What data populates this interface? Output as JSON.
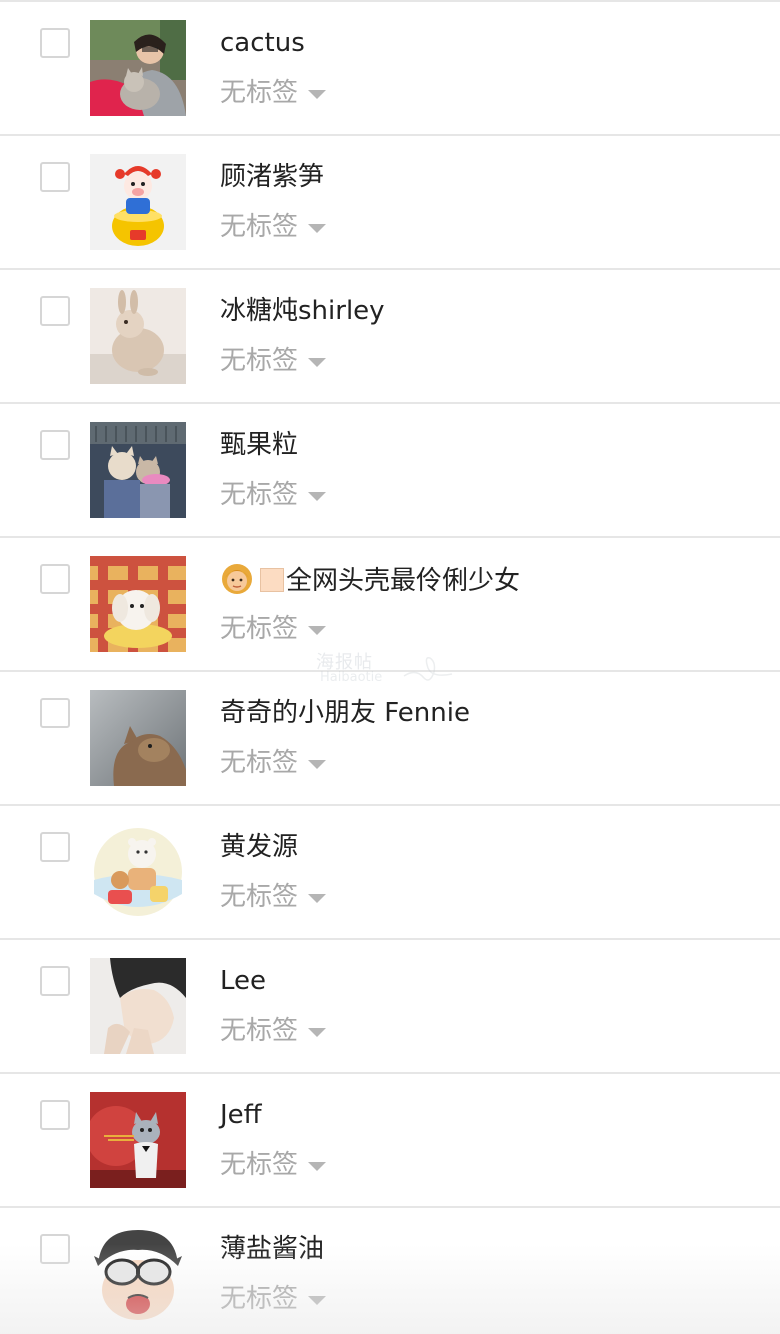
{
  "contacts": [
    {
      "name": "cactus",
      "tag_label": "无标签",
      "avatar": "woman-holding-cat-photo"
    },
    {
      "name": "顾渚紫笋",
      "tag_label": "无标签",
      "avatar": "golden-money-pig-cartoon"
    },
    {
      "name": "冰糖炖shirley",
      "tag_label": "无标签",
      "avatar": "rabbit-photo"
    },
    {
      "name": "甄果粒",
      "tag_label": "无标签",
      "avatar": "two-cats-photo"
    },
    {
      "name": "全网头壳最伶俐少女",
      "tag_label": "无标签",
      "avatar": "white-puppy-on-plaid-photo",
      "name_prefix_icons": [
        "woman-emoji",
        "skin-tone-box"
      ]
    },
    {
      "name": "奇奇的小朋友 Fennie",
      "tag_label": "无标签",
      "avatar": "cat-profile-photo"
    },
    {
      "name": "黄发源",
      "tag_label": "无标签",
      "avatar": "cartoon-bears-circle"
    },
    {
      "name": "Lee",
      "tag_label": "无标签",
      "avatar": "person-portrait-photo"
    },
    {
      "name": "Jeff",
      "tag_label": "无标签",
      "avatar": "tom-cat-cartoon"
    },
    {
      "name": "薄盐酱油",
      "tag_label": "无标签",
      "avatar": "goggles-boy-cartoon"
    }
  ],
  "watermark": {
    "cn": "海报帖",
    "en": "Haibaotie"
  }
}
